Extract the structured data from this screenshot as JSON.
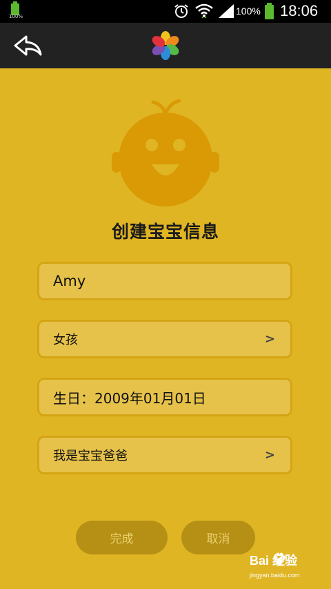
{
  "status_bar": {
    "small_battery_label": "100%",
    "battery_percent": "100%",
    "time": "18:06",
    "icons": [
      "battery-icon",
      "alarm-clock-icon",
      "wifi-icon",
      "cell-signal-icon",
      "battery-full-icon"
    ]
  },
  "action_bar": {
    "back_icon": "back-arrow-icon",
    "logo_icon": "flower-logo-icon"
  },
  "avatar_icon": "baby-face-icon",
  "page_title": "创建宝宝信息",
  "form": {
    "name_value": "Amy",
    "gender_value": "女孩",
    "birthday_value": "生日：2009年01月01日",
    "role_value": "我是宝宝爸爸",
    "chevron": ">"
  },
  "buttons": {
    "done_label": "完成",
    "cancel_label": "取消"
  },
  "watermark": {
    "text": "Bai 经验",
    "sub": "jingyan.baidu.com"
  },
  "colors": {
    "background": "#e0b523",
    "field_fill": "#e6c24a",
    "field_border": "#d4a414",
    "button_fill": "#b59015",
    "avatar": "#d99a05",
    "action_bar": "#222222"
  }
}
